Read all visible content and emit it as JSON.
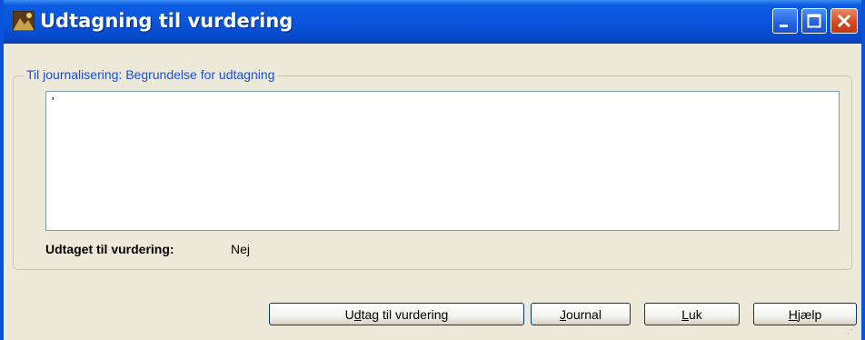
{
  "window": {
    "title": "Udtagning til vurdering",
    "icon": "app-icon",
    "controls": [
      "minimize-icon",
      "maximize-icon",
      "close-icon"
    ]
  },
  "group": {
    "legend": "Til journalisering: Begrundelse for udtagning",
    "text_value": "'"
  },
  "status": {
    "label": "Udtaget til vurdering:",
    "value": "Nej"
  },
  "buttons": {
    "udtag": {
      "before": "U",
      "accel": "d",
      "after": "tag til vurdering"
    },
    "journal": {
      "before": "",
      "accel": "J",
      "after": "ournal"
    },
    "luk": {
      "before": "",
      "accel": "L",
      "after": "uk"
    },
    "hjaelp": {
      "before": "",
      "accel": "H",
      "after": "jælp"
    }
  },
  "colors": {
    "titlebar": "#0a56dc",
    "window_bg": "#ece9d8",
    "legend_text": "#1b4ed8",
    "close_button": "#d44a1f"
  }
}
